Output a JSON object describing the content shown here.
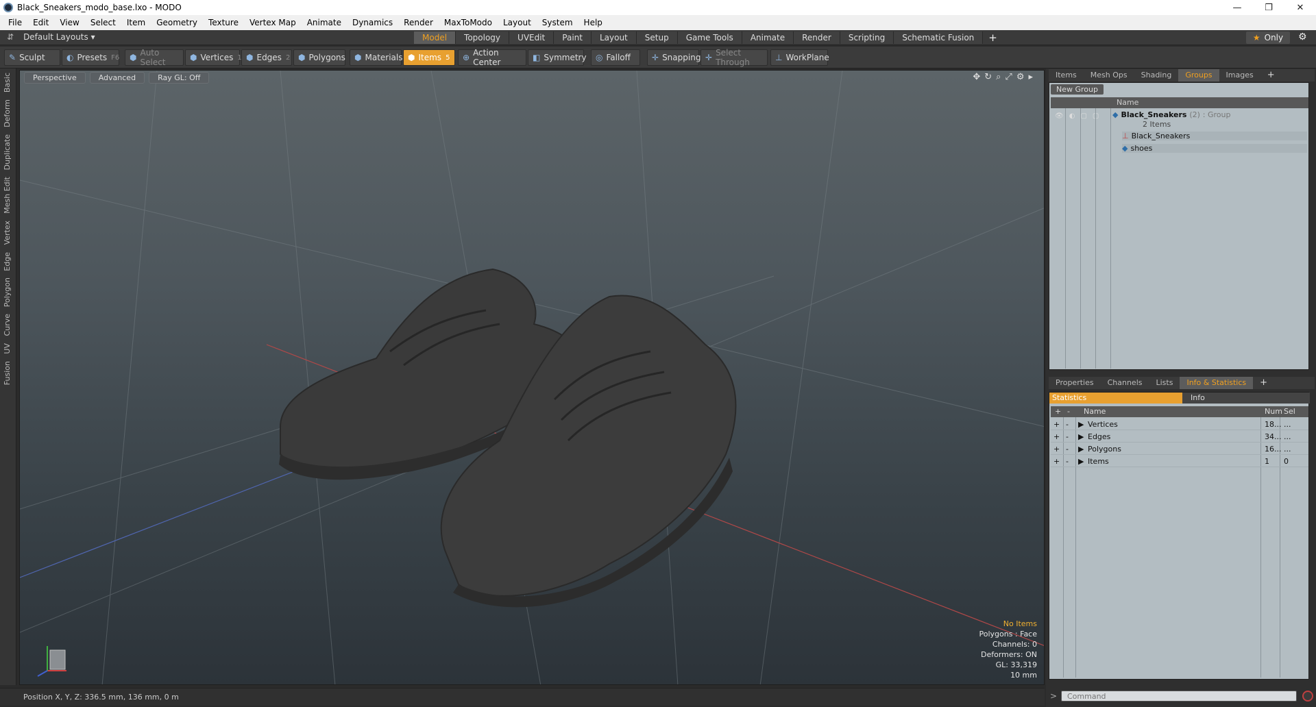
{
  "window": {
    "title": "Black_Sneakers_modo_base.lxo - MODO",
    "controls": [
      "—",
      "❐",
      "✕"
    ]
  },
  "menu": [
    "File",
    "Edit",
    "View",
    "Select",
    "Item",
    "Geometry",
    "Texture",
    "Vertex Map",
    "Animate",
    "Dynamics",
    "Render",
    "MaxToModo",
    "Layout",
    "System",
    "Help"
  ],
  "layoutbar": {
    "layouts": "Default Layouts ▾",
    "only": "Only",
    "tabs": [
      "Model",
      "Topology",
      "UVEdit",
      "Paint",
      "Layout",
      "Setup",
      "Game Tools",
      "Animate",
      "Render",
      "Scripting",
      "Schematic Fusion"
    ]
  },
  "toolbar": {
    "sculpt": "Sculpt",
    "presets": "Presets",
    "presets_key": "F6",
    "auto_select": "Auto Select",
    "vertices": "Vertices",
    "vertices_key": "1",
    "edges": "Edges",
    "edges_key": "2",
    "polygons": "Polygons",
    "materials": "Materials",
    "items": "Items",
    "items_key": "5",
    "action_center": "Action Center",
    "symmetry": "Symmetry",
    "falloff": "Falloff",
    "snapping": "Snapping",
    "select_through": "Select Through",
    "workplane": "WorkPlane"
  },
  "lefttabs": [
    "Basic",
    "Deform",
    "Duplicate",
    "Mesh Edit",
    "Vertex",
    "Edge",
    "Polygon",
    "Curve",
    "UV",
    "Fusion"
  ],
  "viewport": {
    "perspective": "Perspective",
    "advanced": "Advanced",
    "raygl": "Ray GL: Off",
    "hud": {
      "no_items": "No Items",
      "polygons": "Polygons : Face",
      "channels": "Channels: 0",
      "deformers": "Deformers: ON",
      "gl": "GL: 33,319",
      "scale": "10 mm"
    }
  },
  "status": {
    "position": "Position X, Y, Z:   336.5 mm, 136 mm, 0 m"
  },
  "toppanel": {
    "tabs": [
      "Items",
      "Mesh Ops",
      "Shading",
      "Groups",
      "Images"
    ],
    "new_group": "New Group",
    "name_col": "Name",
    "group": {
      "name": "Black_Sneakers",
      "count": "(2)",
      "kind": ": Group",
      "items_label": "2 Items"
    },
    "children": [
      "Black_Sneakers",
      "shoes"
    ]
  },
  "bottompanel": {
    "tabs": [
      "Properties",
      "Channels",
      "Lists",
      "Info & Statistics"
    ],
    "statistics": "Statistics",
    "info": "Info",
    "cols": {
      "name": "Name",
      "num": "Num",
      "sel": "Sel"
    },
    "rows": [
      {
        "name": "Vertices",
        "num": "18...",
        "sel": "..."
      },
      {
        "name": "Edges",
        "num": "34...",
        "sel": "..."
      },
      {
        "name": "Polygons",
        "num": "16...",
        "sel": "..."
      },
      {
        "name": "Items",
        "num": "1",
        "sel": "0"
      }
    ]
  },
  "command": {
    "placeholder": "Command"
  },
  "colors": {
    "accent": "#e8a030",
    "panel_bg": "#b3bdc2"
  }
}
